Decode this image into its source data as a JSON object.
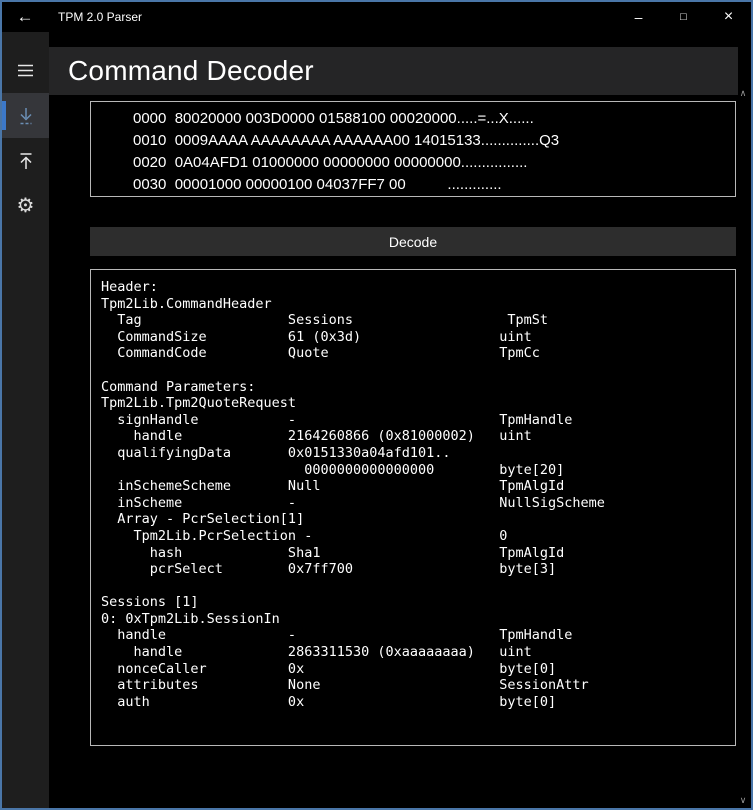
{
  "window": {
    "title": "TPM 2.0 Parser"
  },
  "icons": {
    "back": "←",
    "minimize": "–",
    "maximize": "□",
    "close": "×",
    "gear": "⚙",
    "scroll_up": "∧",
    "scroll_down": "∨"
  },
  "page": {
    "title": "Command Decoder"
  },
  "hexdump": {
    "lines": [
      "0000  80020000 003D0000 01588100 00020000.....=...X......",
      "0010  0009AAAA AAAAAAAA AAAAAA00 14015133..............Q3",
      "0020  0A04AFD1 01000000 00000000 00000000................",
      "0030  00001000 00000100 04037FF7 00          ............."
    ]
  },
  "decode_button": {
    "label": "Decode"
  },
  "output": {
    "lines": [
      "Header:",
      "Tpm2Lib.CommandHeader",
      "  Tag                  Sessions                   TpmSt",
      "  CommandSize          61 (0x3d)                 uint",
      "  CommandCode          Quote                     TpmCc",
      "",
      "Command Parameters:",
      "Tpm2Lib.Tpm2QuoteRequest",
      "  signHandle           -                         TpmHandle",
      "    handle             2164260866 (0x81000002)   uint",
      "  qualifyingData       0x0151330a04afd101..",
      "                         0000000000000000        byte[20]",
      "  inSchemeScheme       Null                      TpmAlgId",
      "  inScheme             -                         NullSigScheme",
      "  Array - PcrSelection[1]",
      "    Tpm2Lib.PcrSelection -                       0",
      "      hash             Sha1                      TpmAlgId",
      "      pcrSelect        0x7ff700                  byte[3]",
      "",
      "Sessions [1]",
      "0: 0xTpm2Lib.SessionIn",
      "  handle               -                         TpmHandle",
      "    handle             2863311530 (0xaaaaaaaa)   uint",
      "  nonceCaller          0x                        byte[0]",
      "  attributes           None                      SessionAttr",
      "  auth                 0x                        byte[0]"
    ]
  },
  "colors": {
    "window_border": "#4a76a8",
    "selection_accent": "#3c78c8",
    "sidebar_bg": "#1e1e1e",
    "header_bg": "#252526",
    "button_bg": "#2d2d2d",
    "box_border": "#b8b8b8",
    "text": "#ffffff"
  }
}
